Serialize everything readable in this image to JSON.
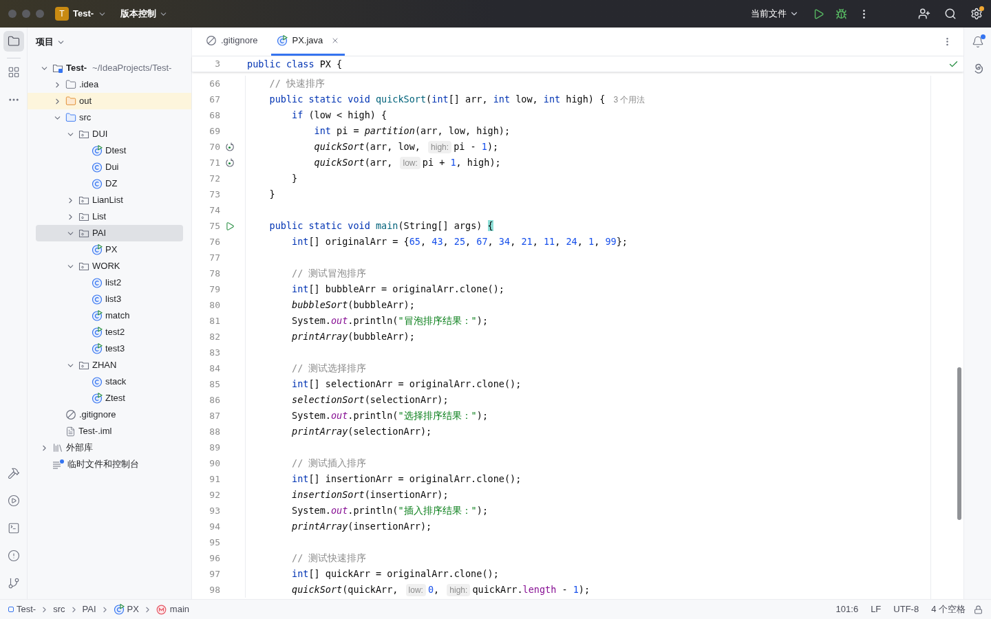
{
  "titlebar": {
    "project_initial": "T",
    "project": "Test-",
    "vcs": "版本控制",
    "run_config": "当前文件"
  },
  "project_panel": {
    "title": "项目",
    "tree": [
      {
        "label": "Test-",
        "path": "~/IdeaProjects/Test-",
        "kind": "root",
        "expanded": true,
        "selected": false,
        "children": [
          {
            "label": ".idea",
            "kind": "folder",
            "expanded": false,
            "selected": false
          },
          {
            "label": "out",
            "kind": "excluded",
            "expanded": false,
            "selected": false
          },
          {
            "label": "src",
            "kind": "source",
            "expanded": true,
            "selected": false,
            "children": [
              {
                "label": "DUI",
                "kind": "package",
                "expanded": true,
                "selected": false,
                "children": [
                  {
                    "label": "Dtest",
                    "kind": "runclass",
                    "selected": false
                  },
                  {
                    "label": "Dui",
                    "kind": "class",
                    "selected": false
                  },
                  {
                    "label": "DZ",
                    "kind": "class",
                    "selected": false
                  }
                ]
              },
              {
                "label": "LianList",
                "kind": "package",
                "expanded": false,
                "selected": false
              },
              {
                "label": "List",
                "kind": "package",
                "expanded": false,
                "selected": false
              },
              {
                "label": "PAI",
                "kind": "package",
                "expanded": true,
                "selected": true,
                "children": [
                  {
                    "label": "PX",
                    "kind": "runclass",
                    "selected": false
                  }
                ]
              },
              {
                "label": "WORK",
                "kind": "package",
                "expanded": true,
                "selected": false,
                "children": [
                  {
                    "label": "list2",
                    "kind": "class",
                    "selected": false
                  },
                  {
                    "label": "list3",
                    "kind": "class",
                    "selected": false
                  },
                  {
                    "label": "match",
                    "kind": "runclass",
                    "selected": false
                  },
                  {
                    "label": "test2",
                    "kind": "runclass",
                    "selected": false
                  },
                  {
                    "label": "test3",
                    "kind": "runclass",
                    "selected": false
                  }
                ]
              },
              {
                "label": "ZHAN",
                "kind": "package",
                "expanded": true,
                "selected": false,
                "children": [
                  {
                    "label": "stack",
                    "kind": "class",
                    "selected": false
                  },
                  {
                    "label": "Ztest",
                    "kind": "runclass",
                    "selected": false
                  }
                ]
              }
            ]
          },
          {
            "label": ".gitignore",
            "kind": "ignore",
            "selected": false
          },
          {
            "label": "Test-.iml",
            "kind": "iml",
            "selected": false
          }
        ]
      },
      {
        "label": "外部库",
        "kind": "library",
        "expanded": false,
        "selected": false
      },
      {
        "label": "临时文件和控制台",
        "kind": "scratch",
        "selected": false
      }
    ]
  },
  "tabs": [
    {
      "label": ".gitignore",
      "kind": "ignore",
      "selected": false
    },
    {
      "label": "PX.java",
      "kind": "runclass",
      "selected": true
    }
  ],
  "sticky_line": {
    "number": "3",
    "tokens": [
      {
        "kind": "keyword",
        "text": "public class "
      },
      {
        "kind": "plain",
        "text": "PX {"
      }
    ]
  },
  "code_lines": [
    {
      "number": "66",
      "tokens": [
        {
          "kind": "comment",
          "text": "    // 快速排序"
        }
      ]
    },
    {
      "number": "67",
      "tokens": [
        {
          "kind": "keyword",
          "text": "    public static void "
        },
        {
          "kind": "function",
          "text": "quickSort"
        },
        {
          "kind": "plain",
          "text": "("
        },
        {
          "kind": "keyword",
          "text": "int"
        },
        {
          "kind": "plain",
          "text": "[] arr, "
        },
        {
          "kind": "keyword",
          "text": "int"
        },
        {
          "kind": "plain",
          "text": " low, "
        },
        {
          "kind": "keyword",
          "text": "int"
        },
        {
          "kind": "plain",
          "text": " high) { "
        },
        {
          "kind": "usages",
          "text": "3 个用法"
        }
      ]
    },
    {
      "number": "68",
      "tokens": [
        {
          "kind": "keyword",
          "text": "        if"
        },
        {
          "kind": "plain",
          "text": " (low < high) {"
        }
      ]
    },
    {
      "number": "69",
      "tokens": [
        {
          "kind": "keyword",
          "text": "            int"
        },
        {
          "kind": "plain",
          "text": " pi = "
        },
        {
          "kind": "call",
          "text": "partition"
        },
        {
          "kind": "plain",
          "text": "(arr, low, high);"
        }
      ]
    },
    {
      "number": "70",
      "gutter": {
        "kind": "recursion"
      },
      "tokens": [
        {
          "kind": "call",
          "text": "            quickSort"
        },
        {
          "kind": "plain",
          "text": "(arr, low, "
        },
        {
          "kind": "hint",
          "text": "high:"
        },
        {
          "kind": "plain",
          "text": "pi - "
        },
        {
          "kind": "number",
          "text": "1"
        },
        {
          "kind": "plain",
          "text": ");"
        }
      ]
    },
    {
      "number": "71",
      "gutter": {
        "kind": "recursion"
      },
      "tokens": [
        {
          "kind": "call",
          "text": "            quickSort"
        },
        {
          "kind": "plain",
          "text": "(arr, "
        },
        {
          "kind": "hint",
          "text": "low:"
        },
        {
          "kind": "plain",
          "text": "pi + "
        },
        {
          "kind": "number",
          "text": "1"
        },
        {
          "kind": "plain",
          "text": ", high);"
        }
      ]
    },
    {
      "number": "72",
      "tokens": [
        {
          "kind": "plain",
          "text": "        }"
        }
      ]
    },
    {
      "number": "73",
      "tokens": [
        {
          "kind": "plain",
          "text": "    }"
        }
      ]
    },
    {
      "number": "74"
    },
    {
      "number": "75",
      "gutter": {
        "kind": "run"
      },
      "tokens": [
        {
          "kind": "keyword",
          "text": "    public static void "
        },
        {
          "kind": "function",
          "text": "main"
        },
        {
          "kind": "plain",
          "text": "(String[] args) "
        },
        {
          "kind": "brace",
          "text": "{"
        }
      ]
    },
    {
      "number": "76",
      "tokens": [
        {
          "kind": "keyword",
          "text": "        int"
        },
        {
          "kind": "plain",
          "text": "[] originalArr = {"
        },
        {
          "kind": "number",
          "text": "65"
        },
        {
          "kind": "plain",
          "text": ", "
        },
        {
          "kind": "number",
          "text": "43"
        },
        {
          "kind": "plain",
          "text": ", "
        },
        {
          "kind": "number",
          "text": "25"
        },
        {
          "kind": "plain",
          "text": ", "
        },
        {
          "kind": "number",
          "text": "67"
        },
        {
          "kind": "plain",
          "text": ", "
        },
        {
          "kind": "number",
          "text": "34"
        },
        {
          "kind": "plain",
          "text": ", "
        },
        {
          "kind": "number",
          "text": "21"
        },
        {
          "kind": "plain",
          "text": ", "
        },
        {
          "kind": "number",
          "text": "11"
        },
        {
          "kind": "plain",
          "text": ", "
        },
        {
          "kind": "number",
          "text": "24"
        },
        {
          "kind": "plain",
          "text": ", "
        },
        {
          "kind": "number",
          "text": "1"
        },
        {
          "kind": "plain",
          "text": ", "
        },
        {
          "kind": "number",
          "text": "99"
        },
        {
          "kind": "plain",
          "text": "};"
        }
      ]
    },
    {
      "number": "77"
    },
    {
      "number": "78",
      "tokens": [
        {
          "kind": "comment",
          "text": "        // 测试冒泡排序"
        }
      ]
    },
    {
      "number": "79",
      "tokens": [
        {
          "kind": "keyword",
          "text": "        int"
        },
        {
          "kind": "plain",
          "text": "[] bubbleArr = originalArr.clone();"
        }
      ]
    },
    {
      "number": "80",
      "tokens": [
        {
          "kind": "call",
          "text": "        bubbleSort"
        },
        {
          "kind": "plain",
          "text": "(bubbleArr);"
        }
      ]
    },
    {
      "number": "81",
      "tokens": [
        {
          "kind": "plain",
          "text": "        System."
        },
        {
          "kind": "static_field",
          "text": "out"
        },
        {
          "kind": "plain",
          "text": ".println("
        },
        {
          "kind": "string",
          "text": "\"冒泡排序结果：\""
        },
        {
          "kind": "plain",
          "text": ");"
        }
      ]
    },
    {
      "number": "82",
      "tokens": [
        {
          "kind": "call",
          "text": "        printArray"
        },
        {
          "kind": "plain",
          "text": "(bubbleArr);"
        }
      ]
    },
    {
      "number": "83"
    },
    {
      "number": "84",
      "tokens": [
        {
          "kind": "comment",
          "text": "        // 测试选择排序"
        }
      ]
    },
    {
      "number": "85",
      "tokens": [
        {
          "kind": "keyword",
          "text": "        int"
        },
        {
          "kind": "plain",
          "text": "[] selectionArr = originalArr.clone();"
        }
      ]
    },
    {
      "number": "86",
      "tokens": [
        {
          "kind": "call",
          "text": "        selectionSort"
        },
        {
          "kind": "plain",
          "text": "(selectionArr);"
        }
      ]
    },
    {
      "number": "87",
      "tokens": [
        {
          "kind": "plain",
          "text": "        System."
        },
        {
          "kind": "static_field",
          "text": "out"
        },
        {
          "kind": "plain",
          "text": ".println("
        },
        {
          "kind": "string",
          "text": "\"选择排序结果：\""
        },
        {
          "kind": "plain",
          "text": ");"
        }
      ]
    },
    {
      "number": "88",
      "tokens": [
        {
          "kind": "call",
          "text": "        printArray"
        },
        {
          "kind": "plain",
          "text": "(selectionArr);"
        }
      ]
    },
    {
      "number": "89"
    },
    {
      "number": "90",
      "tokens": [
        {
          "kind": "comment",
          "text": "        // 测试插入排序"
        }
      ]
    },
    {
      "number": "91",
      "tokens": [
        {
          "kind": "keyword",
          "text": "        int"
        },
        {
          "kind": "plain",
          "text": "[] insertionArr = originalArr.clone();"
        }
      ]
    },
    {
      "number": "92",
      "tokens": [
        {
          "kind": "call",
          "text": "        insertionSort"
        },
        {
          "kind": "plain",
          "text": "(insertionArr);"
        }
      ]
    },
    {
      "number": "93",
      "tokens": [
        {
          "kind": "plain",
          "text": "        System."
        },
        {
          "kind": "static_field",
          "text": "out"
        },
        {
          "kind": "plain",
          "text": ".println("
        },
        {
          "kind": "string",
          "text": "\"插入排序结果：\""
        },
        {
          "kind": "plain",
          "text": ");"
        }
      ]
    },
    {
      "number": "94",
      "tokens": [
        {
          "kind": "call",
          "text": "        printArray"
        },
        {
          "kind": "plain",
          "text": "(insertionArr);"
        }
      ]
    },
    {
      "number": "95"
    },
    {
      "number": "96",
      "tokens": [
        {
          "kind": "comment",
          "text": "        // 测试快速排序"
        }
      ]
    },
    {
      "number": "97",
      "tokens": [
        {
          "kind": "keyword",
          "text": "        int"
        },
        {
          "kind": "plain",
          "text": "[] quickArr = originalArr.clone();"
        }
      ]
    },
    {
      "number": "98",
      "tokens": [
        {
          "kind": "call",
          "text": "        quickSort"
        },
        {
          "kind": "plain",
          "text": "(quickArr, "
        },
        {
          "kind": "hint",
          "text": "low:"
        },
        {
          "kind": "number",
          "text": "0"
        },
        {
          "kind": "plain",
          "text": ", "
        },
        {
          "kind": "hint",
          "text": "high:"
        },
        {
          "kind": "plain",
          "text": "quickArr."
        },
        {
          "kind": "field",
          "text": "length"
        },
        {
          "kind": "plain",
          "text": " - "
        },
        {
          "kind": "number",
          "text": "1"
        },
        {
          "kind": "plain",
          "text": ");"
        }
      ]
    }
  ],
  "status_bar": {
    "breadcrumbs": [
      {
        "label": "Test-",
        "kind": "module"
      },
      {
        "label": "src",
        "kind": "plain"
      },
      {
        "label": "PAI",
        "kind": "plain"
      },
      {
        "label": "PX",
        "kind": "runclass"
      },
      {
        "label": "main",
        "kind": "method"
      }
    ],
    "position": "101:6",
    "line_separator": "LF",
    "encoding": "UTF-8",
    "indent": "4 个空格"
  }
}
